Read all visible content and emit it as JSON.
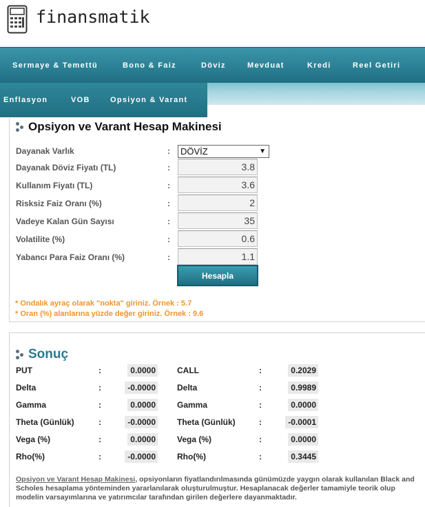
{
  "brand": {
    "name": "finansmatik"
  },
  "nav": {
    "row1": [
      "Sermaye & Temettü",
      "Bono & Faiz",
      "Döviz",
      "Mevduat",
      "Kredi",
      "Reel Getiri"
    ],
    "row2": [
      "Enflasyon",
      "VOB",
      "Opsiyon & Varant"
    ]
  },
  "calculator": {
    "title": "Opsiyon ve Varant Hesap Makinesi",
    "fields": [
      {
        "label": "Dayanak Varlık",
        "value": "DÖVİZ",
        "type": "select"
      },
      {
        "label": "Dayanak Döviz Fiyatı (TL)",
        "value": "3.8"
      },
      {
        "label": "Kullanım Fiyatı (TL)",
        "value": "3.6"
      },
      {
        "label": "Risksiz Faiz Oranı (%)",
        "value": "2"
      },
      {
        "label": "Vadeye Kalan Gün Sayısı",
        "value": "35"
      },
      {
        "label": "Volatilite (%)",
        "value": "0.6"
      },
      {
        "label": "Yabancı Para Faiz Oranı (%)",
        "value": "1.1"
      }
    ],
    "colon": ":",
    "button": "Hesapla",
    "notes": [
      "* Ondalık ayraç olarak \"nokta\" giriniz. Örnek : 5.7",
      "* Oran (%) alanlarına yüzde değer giriniz. Örnek : 9.6"
    ]
  },
  "result": {
    "title": "Sonuç",
    "left": [
      {
        "label": "PUT",
        "value": "0.0000"
      },
      {
        "label": "Delta",
        "value": "-0.0000"
      },
      {
        "label": "Gamma",
        "value": "0.0000"
      },
      {
        "label": "Theta (Günlük)",
        "value": "-0.0000"
      },
      {
        "label": "Vega (%)",
        "value": "0.0000"
      },
      {
        "label": "Rho(%)",
        "value": "-0.0000"
      }
    ],
    "right": [
      {
        "label": "CALL",
        "value": "0.2029"
      },
      {
        "label": "Delta",
        "value": "0.9989"
      },
      {
        "label": "Gamma",
        "value": "0.0000"
      },
      {
        "label": "Theta (Günlük)",
        "value": "-0.0001"
      },
      {
        "label": "Vega (%)",
        "value": "0.0000"
      },
      {
        "label": "Rho(%)",
        "value": "0.3445"
      }
    ]
  },
  "footer": {
    "link": "Opsiyon ve Varant Hesap Makinesi",
    "text": ", opsiyonların fiyatlandırılmasında günümüzde yaygın olarak kullanılan Black and Scholes hesaplama yönteminden yararlanılarak oluşturulmuştur. Hesaplanacak değerler tamamiyle teorik olup modelin varsayımlarına ve yatırımcılar tarafından girilen değerlere dayanmaktadır."
  },
  "colors": {
    "nav": "#2b7f93",
    "accent": "#1f6f83",
    "note": "#f0952a",
    "result_title": "#2a7a90"
  }
}
